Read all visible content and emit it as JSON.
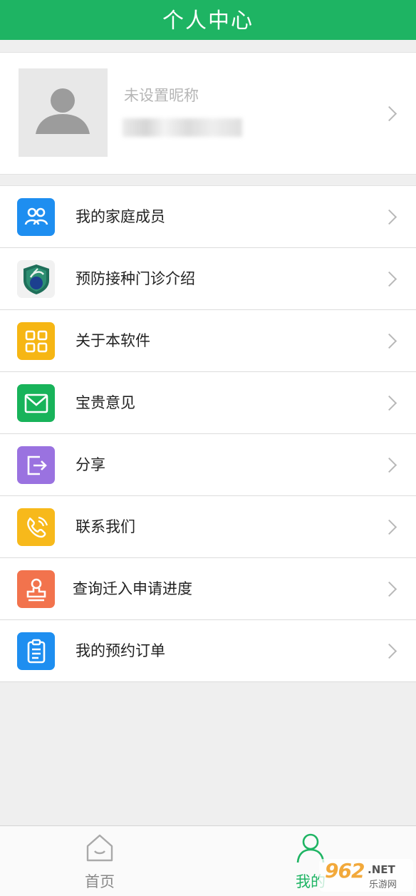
{
  "header": {
    "title": "个人中心"
  },
  "profile": {
    "nickname": "未设置昵称"
  },
  "menu": {
    "items": [
      {
        "label": "我的家庭成员",
        "icon": "family-members-icon",
        "color": "#1e8ef0"
      },
      {
        "label": "预防接种门诊介绍",
        "icon": "cdc-logo-icon",
        "color": "#f1f1f1"
      },
      {
        "label": "关于本软件",
        "icon": "grid-icon",
        "color": "#f6b614"
      },
      {
        "label": "宝贵意见",
        "icon": "mail-icon",
        "color": "#18b35a"
      },
      {
        "label": "分享",
        "icon": "share-icon",
        "color": "#9a72e0"
      },
      {
        "label": "联系我们",
        "icon": "phone-icon",
        "color": "#f7b91b"
      },
      {
        "label": "查询迁入申请进度",
        "icon": "stamp-icon",
        "color": "#f2734d"
      },
      {
        "label": "我的预约订单",
        "icon": "order-list-icon",
        "color": "#1e8ef0"
      }
    ]
  },
  "tabbar": {
    "tabs": [
      {
        "label": "首页",
        "icon": "home-icon",
        "active": false
      },
      {
        "label": "我的",
        "icon": "profile-icon",
        "active": true
      }
    ]
  },
  "watermark": {
    "num": "962",
    "net": ".NET",
    "cn": "乐游网"
  },
  "colors": {
    "brand": "#1eb463",
    "active_tab": "#1eb463",
    "inactive_tab": "#9a9a9a"
  }
}
